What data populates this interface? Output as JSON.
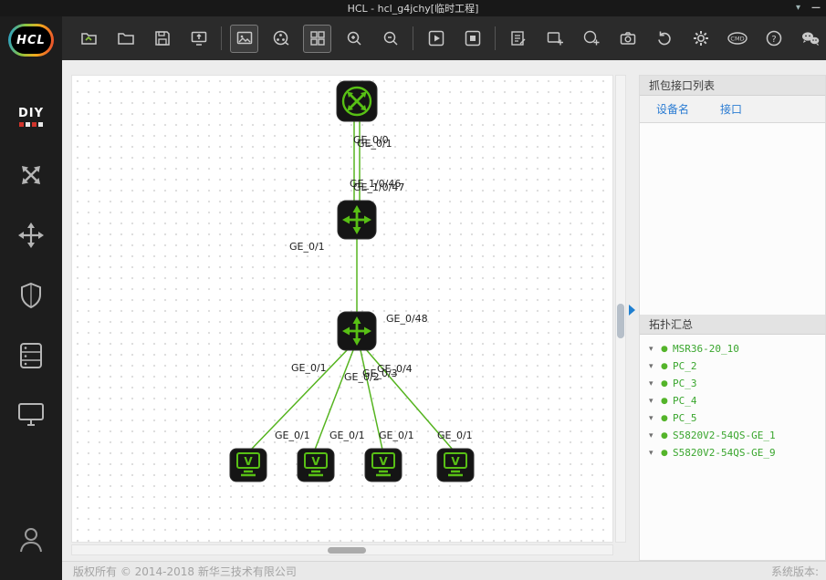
{
  "window": {
    "title": "HCL - hcl_g4jchy[临时工程]"
  },
  "titlebar": {
    "collapse_glyph": "▾",
    "minimize_glyph": "—"
  },
  "toolbar": {
    "cmd_label": "CMD",
    "help_label": "?",
    "icons": [
      "open-project",
      "open-folder",
      "save",
      "export-topology",
      "image-view",
      "packet-reel",
      "grid-view",
      "zoom-in",
      "zoom-out",
      "start-all",
      "stop-all",
      "device-list",
      "add-note",
      "add-oval",
      "snapshot",
      "reset",
      "settings",
      "cli-cmd",
      "help",
      "wechat"
    ]
  },
  "sidebar": {
    "logo_text": "HCL",
    "diy_label": "DIY",
    "items": [
      "diy-devices",
      "topology-devices",
      "routers",
      "security-devices",
      "servers",
      "terminals",
      "user-account"
    ]
  },
  "canvas": {
    "pc_glyph": "V",
    "port_labels": [
      {
        "text": "GE_0/0"
      },
      {
        "text": "GE_0/1"
      },
      {
        "text": "GE_1/0/46"
      },
      {
        "text": "GE_1/0/47"
      },
      {
        "text": "GE_0/1"
      },
      {
        "text": "GE_0/48"
      },
      {
        "text": "GE_0/1"
      },
      {
        "text": "GE_0/2"
      },
      {
        "text": "GE_0/3"
      },
      {
        "text": "GE_0/4"
      },
      {
        "text": "GE_0/1"
      },
      {
        "text": "GE_0/1"
      },
      {
        "text": "GE_0/1"
      },
      {
        "text": "GE_0/1"
      }
    ],
    "devices": [
      "MSR36-20_10",
      "S5820V2-54QS-GE_1",
      "S5820V2-54QS-GE_9",
      "PC_2",
      "PC_3",
      "PC_4",
      "PC_5"
    ]
  },
  "right_panel": {
    "capture_title": "抓包接口列表",
    "columns": {
      "device": "设备名",
      "interface": "接口"
    },
    "summary_title": "拓扑汇总",
    "tree": [
      {
        "label": "MSR36-20_10"
      },
      {
        "label": "PC_2"
      },
      {
        "label": "PC_3"
      },
      {
        "label": "PC_4"
      },
      {
        "label": "PC_5"
      },
      {
        "label": "S5820V2-54QS-GE_1"
      },
      {
        "label": "S5820V2-54QS-GE_9"
      }
    ]
  },
  "statusbar": {
    "left": "版权所有 © 2014-2018 新华三技术有限公司",
    "right": "系统版本:"
  }
}
